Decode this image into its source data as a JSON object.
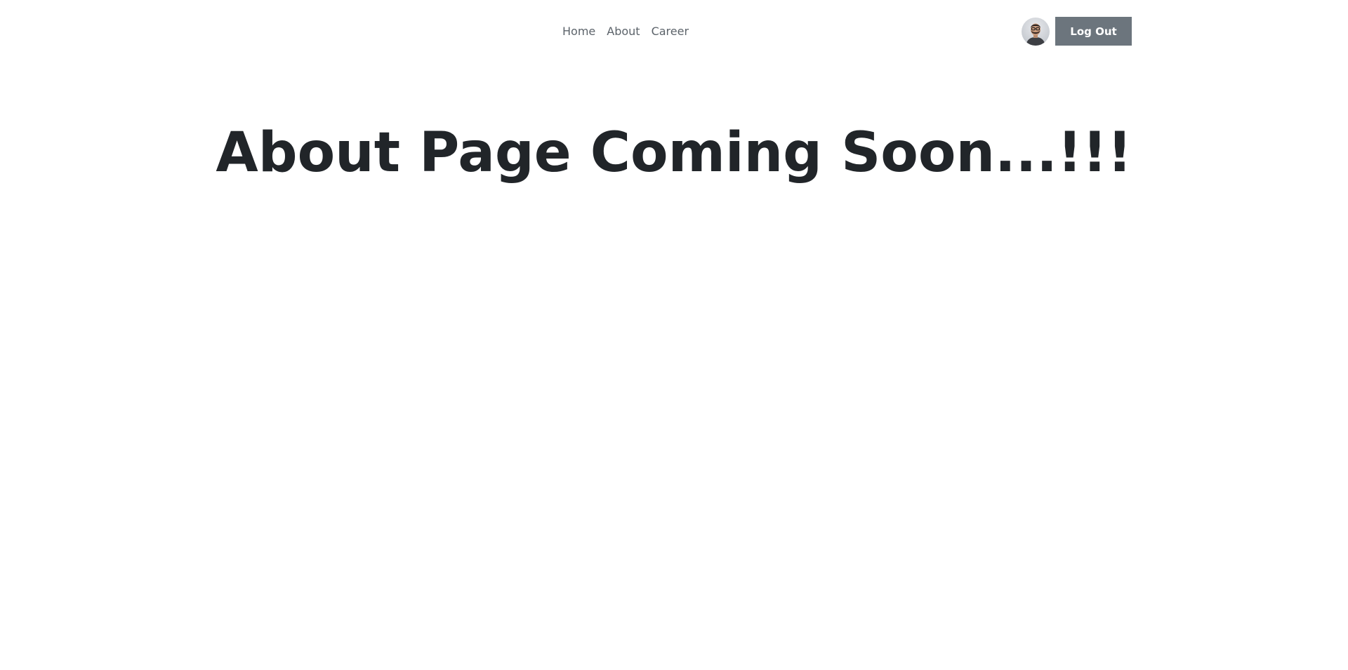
{
  "nav": {
    "items": [
      {
        "label": "Home"
      },
      {
        "label": "About"
      },
      {
        "label": "Career"
      }
    ]
  },
  "user": {
    "avatar_icon": "user-avatar",
    "logout_label": "Log Out"
  },
  "main": {
    "title": "About Page Coming Soon...!!!"
  },
  "colors": {
    "logout_bg": "#6c757d",
    "title_text": "#212529",
    "nav_text": "#5c636a"
  }
}
